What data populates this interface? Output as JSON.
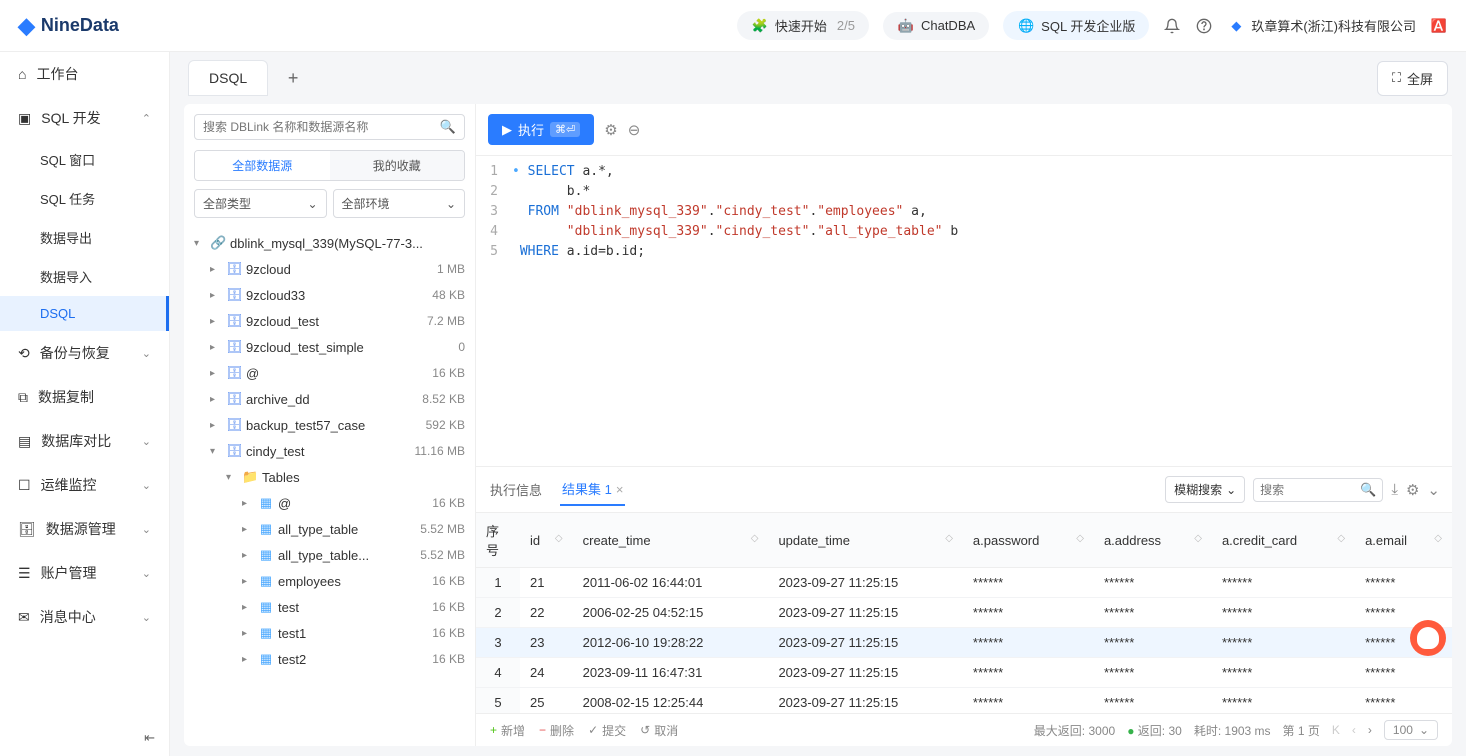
{
  "brand": "NineData",
  "header": {
    "quickstart": {
      "label": "快速开始",
      "progress": "2/5"
    },
    "chatdba": "ChatDBA",
    "sql_edition": "SQL 开发企业版",
    "org": "玖章算术(浙江)科技有限公司"
  },
  "sidebar": {
    "workbench": "工作台",
    "sql_dev": "SQL 开发",
    "sql_window": "SQL 窗口",
    "sql_task": "SQL 任务",
    "data_export": "数据导出",
    "data_import": "数据导入",
    "dsql": "DSQL",
    "backup": "备份与恢复",
    "replication": "数据复制",
    "db_compare": "数据库对比",
    "ops_monitor": "运维监控",
    "datasource_mgmt": "数据源管理",
    "account_mgmt": "账户管理",
    "message_center": "消息中心"
  },
  "tabs": {
    "active": "DSQL"
  },
  "fullscreen": "全屏",
  "tree": {
    "search_placeholder": "搜索 DBLink 名称和数据源名称",
    "tab_all": "全部数据源",
    "tab_fav": "我的收藏",
    "select_type": "全部类型",
    "select_env": "全部环境",
    "root": "dblink_mysql_339(MySQL-77-3...",
    "nodes": [
      {
        "name": "9zcloud",
        "size": "1 MB",
        "icon": "db",
        "ind": 1,
        "caret": "▸"
      },
      {
        "name": "9zcloud33",
        "size": "48 KB",
        "icon": "db",
        "ind": 1,
        "caret": "▸"
      },
      {
        "name": "9zcloud_test",
        "size": "7.2 MB",
        "icon": "db",
        "ind": 1,
        "caret": "▸"
      },
      {
        "name": "9zcloud_test_simple",
        "size": "0",
        "icon": "db",
        "ind": 1,
        "caret": "▸"
      },
      {
        "name": "@",
        "size": "16 KB",
        "icon": "db",
        "ind": 1,
        "caret": "▸"
      },
      {
        "name": "archive_dd",
        "size": "8.52 KB",
        "icon": "db",
        "ind": 1,
        "caret": "▸"
      },
      {
        "name": "backup_test57_case",
        "size": "592 KB",
        "icon": "db",
        "ind": 1,
        "caret": "▸"
      },
      {
        "name": "cindy_test",
        "size": "11.16 MB",
        "icon": "db",
        "ind": 1,
        "caret": "▾"
      },
      {
        "name": "Tables",
        "size": "",
        "icon": "folder",
        "ind": 2,
        "caret": "▾"
      },
      {
        "name": "@",
        "size": "16 KB",
        "icon": "tbl",
        "ind": 3,
        "caret": "▸"
      },
      {
        "name": "all_type_table",
        "size": "5.52 MB",
        "icon": "tbl",
        "ind": 3,
        "caret": "▸"
      },
      {
        "name": "all_type_table...",
        "size": "5.52 MB",
        "icon": "tbl",
        "ind": 3,
        "caret": "▸"
      },
      {
        "name": "employees",
        "size": "16 KB",
        "icon": "tbl",
        "ind": 3,
        "caret": "▸"
      },
      {
        "name": "test",
        "size": "16 KB",
        "icon": "tbl",
        "ind": 3,
        "caret": "▸"
      },
      {
        "name": "test1",
        "size": "16 KB",
        "icon": "tbl",
        "ind": 3,
        "caret": "▸"
      },
      {
        "name": "test2",
        "size": "16 KB",
        "icon": "tbl",
        "ind": 3,
        "caret": "▸"
      }
    ]
  },
  "toolbar": {
    "run": "执行",
    "shortcut": "⌘⏎"
  },
  "sql_lines": [
    {
      "n": "1"
    },
    {
      "n": "2"
    },
    {
      "n": "3"
    },
    {
      "n": "4"
    },
    {
      "n": "5"
    }
  ],
  "sql": {
    "l1a": "SELECT",
    "l1b": " a.*,",
    "l2": "       b.*",
    "l3a": "  FROM ",
    "l3b": "\"dblink_mysql_339\"",
    "l3c": ".",
    "l3d": "\"cindy_test\"",
    "l3e": ".",
    "l3f": "\"employees\"",
    "l3g": " a,",
    "l4a": "       ",
    "l4b": "\"dblink_mysql_339\"",
    "l4c": ".",
    "l4d": "\"cindy_test\"",
    "l4e": ".",
    "l4f": "\"all_type_table\"",
    "l4g": " b",
    "l5a": " WHERE",
    "l5b": " a.id=b.id;"
  },
  "results": {
    "tab_info": "执行信息",
    "tab_set": "结果集 1",
    "search_mode": "模糊搜索",
    "search_placeholder": "搜索",
    "columns": [
      "序号",
      "id",
      "create_time",
      "update_time",
      "a.password",
      "a.address",
      "a.credit_card",
      "a.email"
    ],
    "rows": [
      {
        "n": "1",
        "id": "21",
        "ct": "2011-06-02 16:44:01",
        "ut": "2023-09-27 11:25:15",
        "pw": "******",
        "ad": "******",
        "cc": "******",
        "em": "******"
      },
      {
        "n": "2",
        "id": "22",
        "ct": "2006-02-25 04:52:15",
        "ut": "2023-09-27 11:25:15",
        "pw": "******",
        "ad": "******",
        "cc": "******",
        "em": "******"
      },
      {
        "n": "3",
        "id": "23",
        "ct": "2012-06-10 19:28:22",
        "ut": "2023-09-27 11:25:15",
        "pw": "******",
        "ad": "******",
        "cc": "******",
        "em": "******",
        "hl": true
      },
      {
        "n": "4",
        "id": "24",
        "ct": "2023-09-11 16:47:31",
        "ut": "2023-09-27 11:25:15",
        "pw": "******",
        "ad": "******",
        "cc": "******",
        "em": "******"
      },
      {
        "n": "5",
        "id": "25",
        "ct": "2008-02-15 12:25:44",
        "ut": "2023-09-27 11:25:15",
        "pw": "******",
        "ad": "******",
        "cc": "******",
        "em": "******"
      }
    ]
  },
  "footer": {
    "add": "新增",
    "del": "删除",
    "submit": "提交",
    "cancel": "取消",
    "max_return_label": "最大返回:",
    "max_return": "3000",
    "return_label": "返回:",
    "return": "30",
    "elapsed_label": "耗时:",
    "elapsed": "1903 ms",
    "page_label": "第 1 页",
    "page_size": "100"
  }
}
